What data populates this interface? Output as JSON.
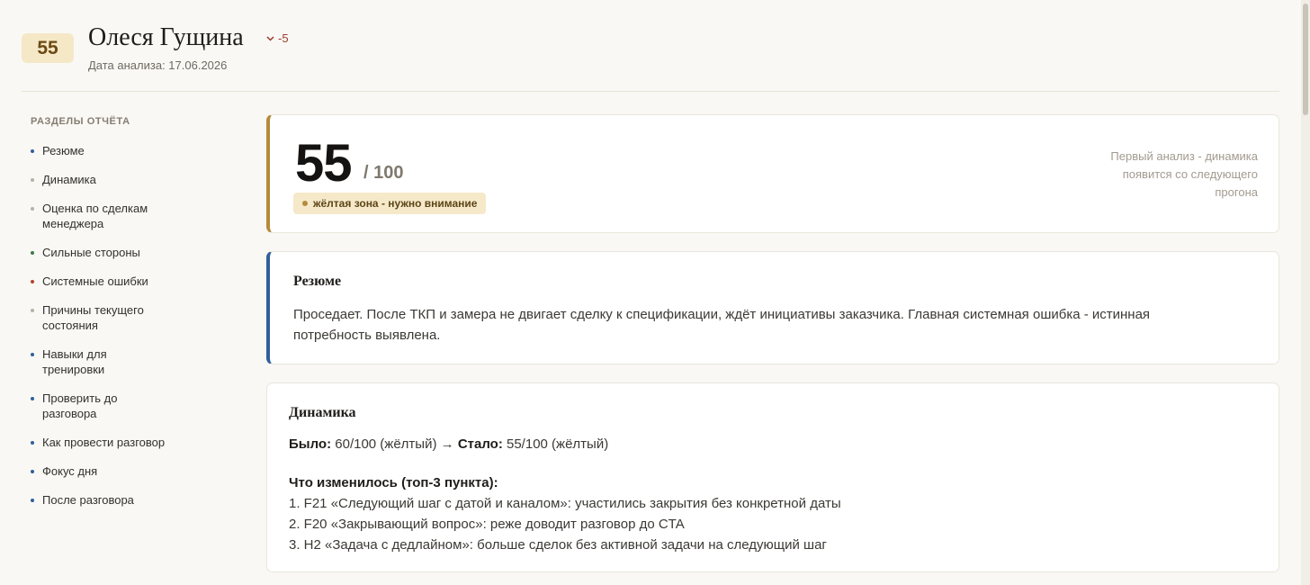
{
  "header": {
    "score": "55",
    "name": "Олеся Гущина",
    "trend_delta": "-5",
    "trend_icon": "chevron-down-icon",
    "date_label": "Дата анализа: 17.06.2026"
  },
  "sidebar": {
    "title": "РАЗДЕЛЫ ОТЧЁТА",
    "items": [
      {
        "label": "Резюме",
        "color": "#2f5f9e"
      },
      {
        "label": "Динамика",
        "color": "#b8b2a6"
      },
      {
        "label": "Оценка по сделкам менеджера",
        "color": "#b8b2a6"
      },
      {
        "label": "Сильные стороны",
        "color": "#3f7a4a"
      },
      {
        "label": "Системные ошибки",
        "color": "#b5412e"
      },
      {
        "label": "Причины текущего состояния",
        "color": "#b8b2a6"
      },
      {
        "label": "Навыки для тренировки",
        "color": "#2f5f9e"
      },
      {
        "label": "Проверить до разговора",
        "color": "#2f5f9e"
      },
      {
        "label": "Как провести разговор",
        "color": "#2f5f9e"
      },
      {
        "label": "Фокус дня",
        "color": "#2f5f9e"
      },
      {
        "label": "После разговора",
        "color": "#2f5f9e"
      }
    ]
  },
  "score_card": {
    "score": "55",
    "max": "/ 100",
    "zone": "жёлтая зона - нужно внимание",
    "note": "Первый анализ - динамика появится со следующего прогона",
    "accent": "#b58a3c"
  },
  "resume": {
    "title": "Резюме",
    "text": "Проседает. После ТКП и замера не двигает сделку к спецификации, ждёт инициативы заказчика. Главная системная ошибка - истинная потребность выявлена.",
    "accent": "#2f5f9e"
  },
  "dynamics": {
    "title": "Динамика",
    "was_label": "Было:",
    "was_value": "60/100 (жёлтый)",
    "arrow": "→",
    "now_label": "Стало:",
    "now_value": "55/100 (жёлтый)",
    "changes_title": "Что изменилось (топ-3 пункта):",
    "changes": [
      "1. F21 «Следующий шаг с датой и каналом»: участились закрытия без конкретной даты",
      "2. F20 «Закрывающий вопрос»: реже доводит разговор до CTA",
      "3. H2 «Задача с дедлайном»: больше сделок без активной задачи на следующий шаг"
    ]
  }
}
